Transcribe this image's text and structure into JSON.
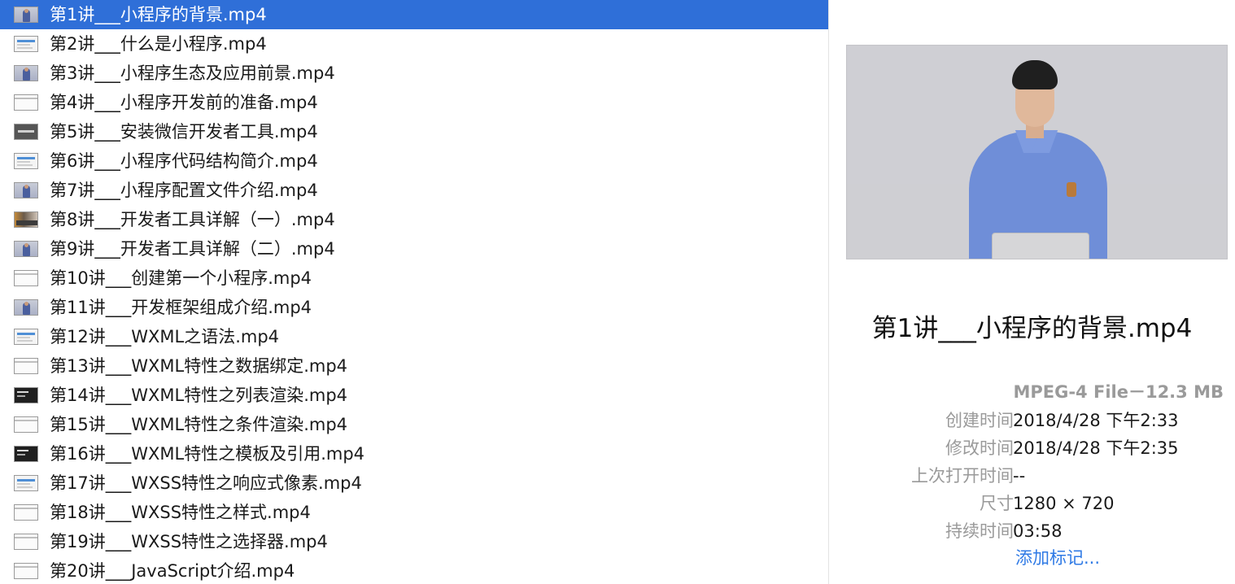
{
  "files": [
    {
      "name": "第1讲___小程序的背景.mp4",
      "thumb": "person",
      "selected": true
    },
    {
      "name": "第2讲___什么是小程序.mp4",
      "thumb": "slide"
    },
    {
      "name": "第3讲___小程序生态及应用前景.mp4",
      "thumb": "person"
    },
    {
      "name": "第4讲___小程序开发前的准备.mp4",
      "thumb": "blank"
    },
    {
      "name": "第5讲___安装微信开发者工具.mp4",
      "thumb": "dark"
    },
    {
      "name": "第6讲___小程序代码结构简介.mp4",
      "thumb": "slide"
    },
    {
      "name": "第7讲___小程序配置文件介绍.mp4",
      "thumb": "person"
    },
    {
      "name": "第8讲___开发者工具详解（一）.mp4",
      "thumb": "scene"
    },
    {
      "name": "第9讲___开发者工具详解（二）.mp4",
      "thumb": "person"
    },
    {
      "name": "第10讲___创建第一个小程序.mp4",
      "thumb": "blank"
    },
    {
      "name": "第11讲___开发框架组成介绍.mp4",
      "thumb": "person"
    },
    {
      "name": "第12讲___WXML之语法.mp4",
      "thumb": "slide"
    },
    {
      "name": "第13讲___WXML特性之数据绑定.mp4",
      "thumb": "blank"
    },
    {
      "name": "第14讲___WXML特性之列表渲染.mp4",
      "thumb": "code"
    },
    {
      "name": "第15讲___WXML特性之条件渲染.mp4",
      "thumb": "blank"
    },
    {
      "name": "第16讲___WXML特性之模板及引用.mp4",
      "thumb": "code"
    },
    {
      "name": "第17讲___WXSS特性之响应式像素.mp4",
      "thumb": "slide"
    },
    {
      "name": "第18讲___WXSS特性之样式.mp4",
      "thumb": "blank"
    },
    {
      "name": "第19讲___WXSS特性之选择器.mp4",
      "thumb": "blank"
    },
    {
      "name": "第20讲___JavaScript介绍.mp4",
      "thumb": "blank"
    }
  ],
  "preview": {
    "title": "第1讲___小程序的背景.mp4",
    "kind_size": "MPEG-4 File－12.3 MB",
    "meta": [
      {
        "label": "创建时间",
        "value": "2018/4/28 下午2:33"
      },
      {
        "label": "修改时间",
        "value": "2018/4/28 下午2:35"
      },
      {
        "label": "上次打开时间",
        "value": "--"
      },
      {
        "label": "尺寸",
        "value": "1280 × 720"
      },
      {
        "label": "持续时间",
        "value": "03:58"
      }
    ],
    "add_tags": "添加标记..."
  },
  "colors": {
    "selection": "#2f6fd8",
    "link": "#2f7ae5"
  }
}
